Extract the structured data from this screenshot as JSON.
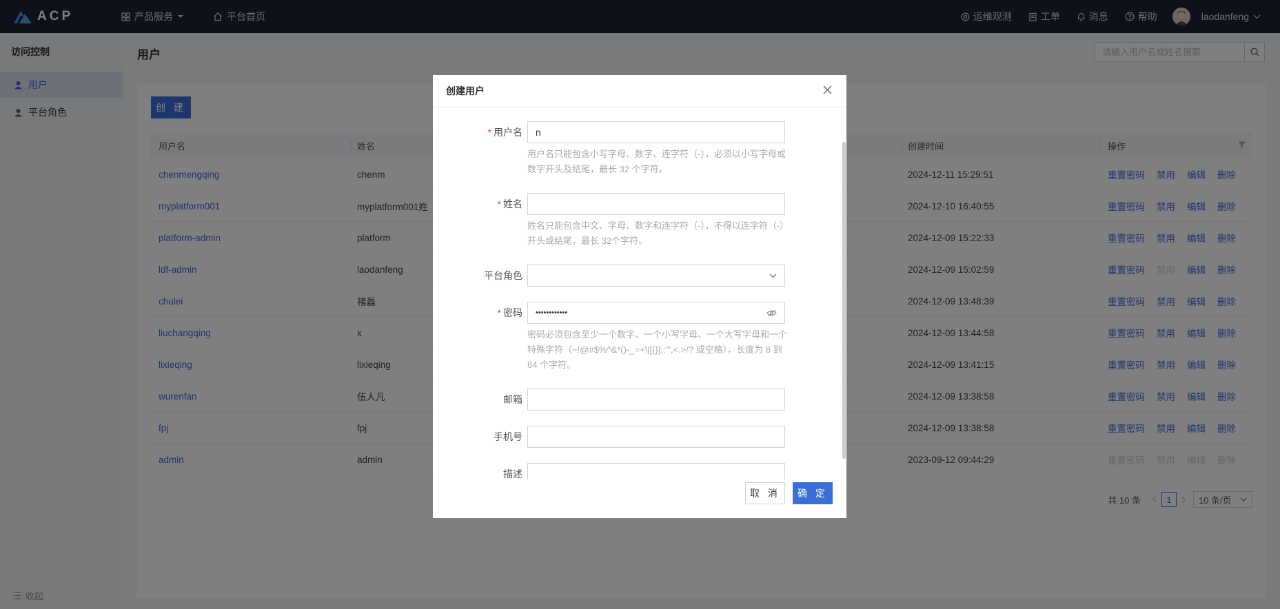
{
  "topbar": {
    "logo_text": "ACP",
    "nav": [
      {
        "label": "产品服务",
        "icon": "grid-icon"
      },
      {
        "label": "平台首页",
        "icon": "home-icon"
      }
    ],
    "right": [
      {
        "label": "运维观测",
        "icon": "target-icon"
      },
      {
        "label": "工单",
        "icon": "clipboard-icon"
      },
      {
        "label": "消息",
        "icon": "bell-icon"
      },
      {
        "label": "帮助",
        "icon": "help-circle-icon"
      }
    ],
    "username": "laodanfeng"
  },
  "sidebar": {
    "title": "访问控制",
    "items": [
      {
        "label": "用户",
        "icon": "user-icon",
        "active": true
      },
      {
        "label": "平台角色",
        "icon": "user-role-icon",
        "active": false
      }
    ],
    "collapse_label": "收起"
  },
  "page": {
    "title": "用户",
    "search_placeholder": "请输入用户名或姓名搜索",
    "create_label": "创 建"
  },
  "table": {
    "headers": [
      "用户名",
      "姓名",
      "创建时间",
      "操作"
    ],
    "actions": [
      "重置密码",
      "禁用",
      "编辑",
      "删除"
    ],
    "rows": [
      {
        "username": "chenmengqing",
        "name": "chenm",
        "created": "2024-12-11 15:29:51",
        "disabled": []
      },
      {
        "username": "myplatform001",
        "name": "myplatform001姓",
        "created": "2024-12-10 16:40:55",
        "disabled": []
      },
      {
        "username": "platform-admin",
        "name": "platform",
        "created": "2024-12-09 15:22:33",
        "disabled": []
      },
      {
        "username": "ldf-admin",
        "name": "laodanfeng",
        "created": "2024-12-09 15:02:59",
        "disabled": [
          1
        ]
      },
      {
        "username": "chulei",
        "name": "褚磊",
        "created": "2024-12-09 13:48:39",
        "disabled": []
      },
      {
        "username": "liuchangqing",
        "name": "x",
        "created": "2024-12-09 13:44:58",
        "disabled": []
      },
      {
        "username": "lixieqing",
        "name": "lixieqing",
        "created": "2024-12-09 13:41:15",
        "disabled": []
      },
      {
        "username": "wurenfan",
        "name": "伍人凡",
        "created": "2024-12-09 13:38:58",
        "disabled": []
      },
      {
        "username": "fpj",
        "name": "fpj",
        "created": "2024-12-09 13:38:58",
        "disabled": []
      },
      {
        "username": "admin",
        "name": "admin",
        "created": "2023-09-12 09:44:29",
        "disabled": [
          0,
          1,
          2,
          3
        ]
      }
    ]
  },
  "pagination": {
    "total": "共 10 条",
    "current": "1",
    "page_size": "10 条/页"
  },
  "dialog": {
    "title": "创建用户",
    "fields": {
      "username": {
        "label": "用户名",
        "value": "n",
        "hint": "用户名只能包含小写字母、数字、连字符（-），必须以小写字母或数字开头及结尾，最长 32 个字符。"
      },
      "name": {
        "label": "姓名",
        "value": "",
        "hint": "姓名只能包含中文、字母、数字和连字符（-），不得以连字符（-）开头或结尾，最长 32个字符。"
      },
      "role": {
        "label": "平台角色",
        "value": ""
      },
      "password": {
        "label": "密码",
        "value": "••••••••••••",
        "hint": "密码必须包含至少一个数字、一个小写字母、一个大写字母和一个特殊字符（~!@#$%^&*()-_=+\\|[{}];:'\",<.>/? 或空格），长度为 8 到 64 个字符。"
      },
      "email": {
        "label": "邮箱",
        "value": ""
      },
      "phone": {
        "label": "手机号",
        "value": ""
      },
      "description": {
        "label": "描述",
        "value": ""
      }
    },
    "cancel_label": "取 消",
    "ok_label": "确 定"
  }
}
